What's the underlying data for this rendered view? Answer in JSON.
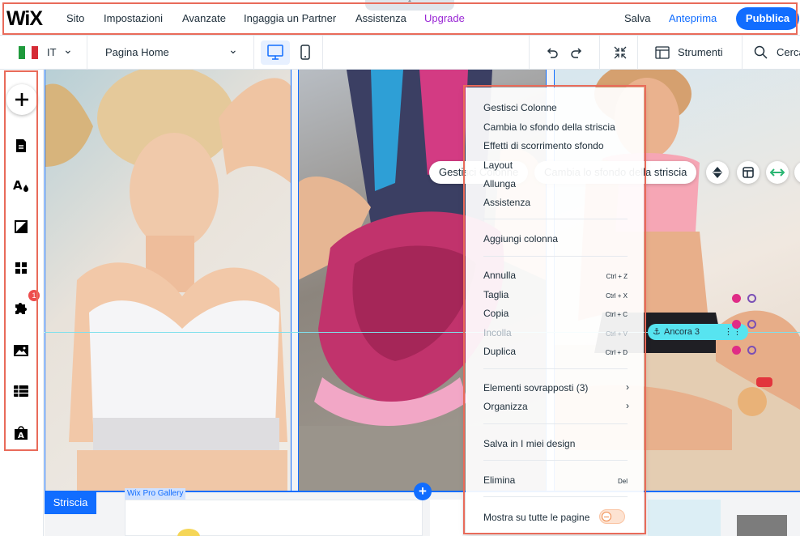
{
  "topbar": {
    "logo": "WiX",
    "collapse_icon": "chevron-up-icon",
    "nav": [
      {
        "label": "Sito"
      },
      {
        "label": "Impostazioni"
      },
      {
        "label": "Avanzate"
      },
      {
        "label": "Ingaggia un Partner"
      },
      {
        "label": "Assistenza"
      },
      {
        "label": "Upgrade"
      }
    ],
    "save": "Salva",
    "preview": "Anteprima",
    "publish": "Pubblica"
  },
  "toolbar": {
    "language": "IT",
    "page": "Pagina Home",
    "tools": "Strumenti",
    "search": "Cerca"
  },
  "sidebar": {
    "badge": "1",
    "icons": [
      "plus-icon",
      "page-icon",
      "theme-icon",
      "background-icon",
      "apps-icon",
      "puzzle-icon",
      "image-icon",
      "table-icon",
      "store-icon"
    ]
  },
  "canvas": {
    "strip_label": "Striscia",
    "gallery_label": "Wix Pro Gallery",
    "float_bar": {
      "manage": "Gestisci Colonne",
      "change_bg": "Cambia lo sfondo della striscia"
    },
    "anchor": "Ancora 3"
  },
  "context_menu": {
    "group1": [
      "Gestisci Colonne",
      "Cambia lo sfondo della striscia",
      "Effetti di scorrimento sfondo",
      "Layout",
      "Allunga",
      "Assistenza"
    ],
    "group2": [
      "Aggiungi colonna"
    ],
    "group3": [
      {
        "label": "Annulla",
        "shortcut": "Ctrl + Z"
      },
      {
        "label": "Taglia",
        "shortcut": "Ctrl + X"
      },
      {
        "label": "Copia",
        "shortcut": "Ctrl + C"
      },
      {
        "label": "Incolla",
        "shortcut": "Ctrl + V"
      },
      {
        "label": "Duplica",
        "shortcut": "Ctrl + D"
      }
    ],
    "group4": [
      "Elementi sovrapposti (3)",
      "Organizza"
    ],
    "group5": [
      "Salva in I miei design"
    ],
    "group6": [
      {
        "label": "Elimina",
        "shortcut": "Del"
      }
    ],
    "group7": [
      "Mostra su tutte le pagine"
    ]
  },
  "colors": {
    "accent": "#116dff",
    "upgrade": "#9a27d5",
    "highlight_outline": "#e96b5a",
    "anchor": "#57e4f0"
  }
}
